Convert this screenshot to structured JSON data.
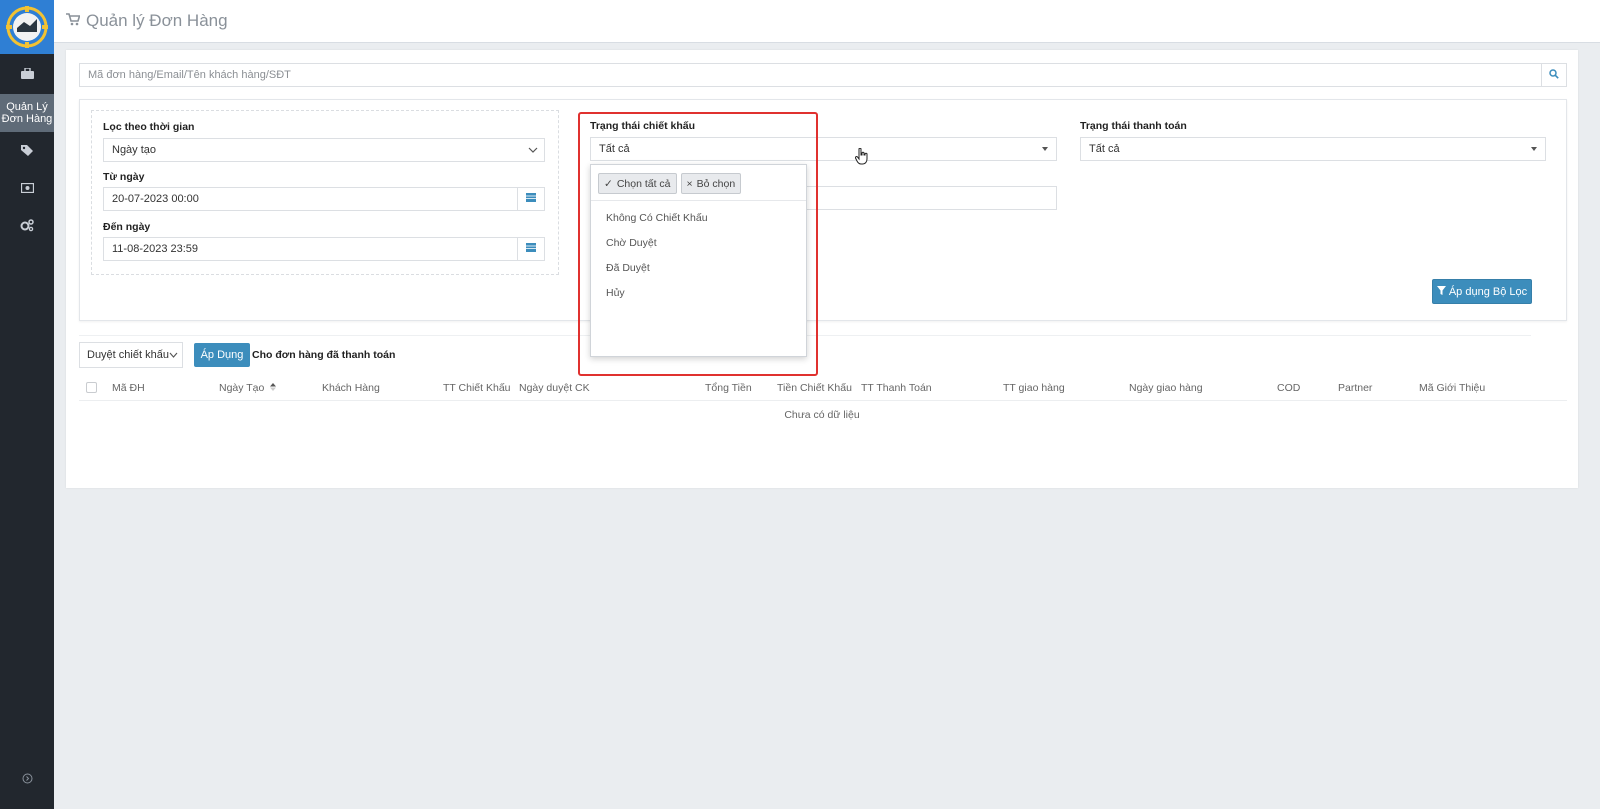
{
  "app": {
    "title": "Quản lý Đơn Hàng"
  },
  "sidebar": {
    "items": [
      {
        "icon": "briefcase-icon"
      },
      {
        "label": "Quản Lý Đơn Hàng",
        "active": true
      },
      {
        "icon": "tags-icon"
      },
      {
        "icon": "money-icon"
      },
      {
        "icon": "cogs-icon"
      }
    ],
    "bottom_icon": "circle-arrow-icon"
  },
  "search": {
    "placeholder": "Mã đơn hàng/Email/Tên khách hàng/SĐT"
  },
  "filters": {
    "time_filter": {
      "label": "Lọc theo thời gian",
      "value": "Ngày tạo"
    },
    "from_date": {
      "label": "Từ ngày",
      "value": "20-07-2023 00:00"
    },
    "to_date": {
      "label": "Đến ngày",
      "value": "11-08-2023 23:59"
    },
    "discount_status": {
      "label": "Trạng thái chiết khấu",
      "value": "Tất cả"
    },
    "payment_status": {
      "label": "Trạng thái thanh toán",
      "value": "Tất cả"
    },
    "apply_label": "Áp dụng Bộ Lọc"
  },
  "dropdown": {
    "select_all": "Chọn tất cả",
    "deselect": "Bỏ chọn",
    "options": [
      "Không Có Chiết Khấu",
      "Chờ Duyệt",
      "Đã Duyệt",
      "Hủy"
    ]
  },
  "bulk": {
    "action_value": "Duyệt chiết khấu",
    "apply_label": "Áp Dụng",
    "note": "Cho đơn hàng đã thanh toán"
  },
  "table": {
    "columns": [
      "Mã ĐH",
      "Ngày Tạo",
      "Khách Hàng",
      "TT Chiết Khấu",
      "Ngày duyệt CK",
      "Tổng Tiền",
      "Tiền Chiết Khấu",
      "TT Thanh Toán",
      "TT giao hàng",
      "Ngày giao hàng",
      "COD",
      "Partner",
      "Mã Giới Thiệu"
    ],
    "empty_text": "Chưa có dữ liệu"
  },
  "colors": {
    "primary": "#3c8dbc",
    "sidebar": "#22272e",
    "highlight": "#e0312f"
  }
}
